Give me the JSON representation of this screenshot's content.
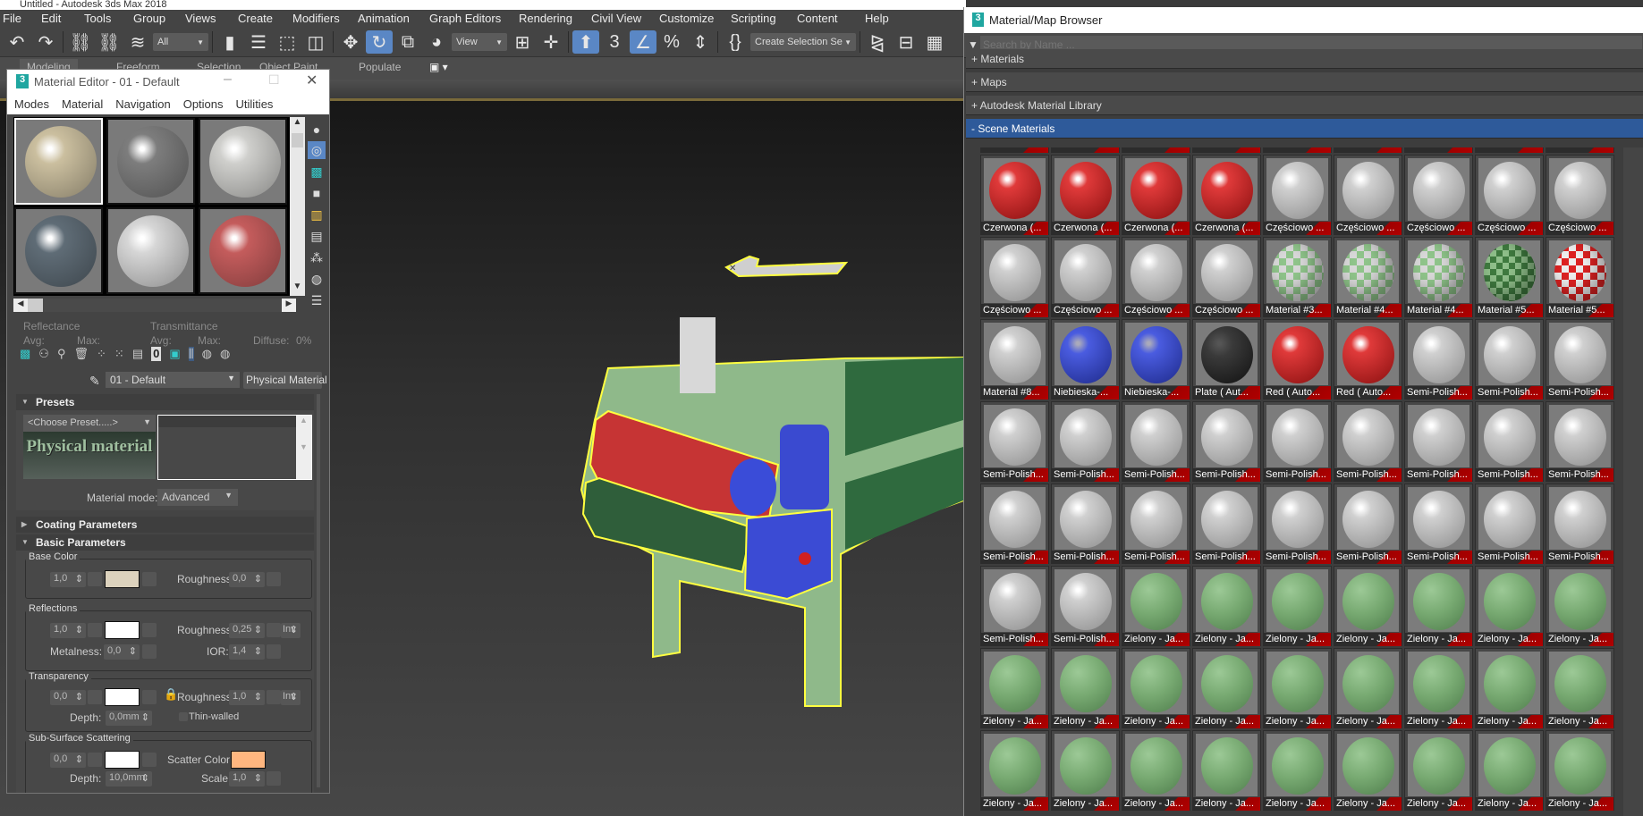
{
  "app": {
    "title": "Untitled - Autodesk 3ds Max 2018"
  },
  "menu": [
    "File",
    "Edit",
    "Tools",
    "Group",
    "Views",
    "Create",
    "Modifiers",
    "Animation",
    "Graph Editors",
    "Rendering",
    "Civil View",
    "Customize",
    "Scripting",
    "Content",
    "Help"
  ],
  "toolbar": {
    "selection_filter": "All",
    "ref_coord": "View",
    "named_selection": "Create Selection Se",
    "icons": [
      "undo-icon",
      "redo-icon",
      "link-icon",
      "unlink-icon",
      "bind-space-warp-icon",
      "select-object-icon",
      "select-by-name-icon",
      "rectangular-selection-icon",
      "window-crossing-icon",
      "move-icon",
      "rotate-icon",
      "scale-icon",
      "place-icon",
      "use-pivot-icon",
      "select-manipulate-icon",
      "keyboard-shortcut-override-icon",
      "snaps-toggle-icon",
      "angle-snap-icon",
      "percent-snap-icon",
      "spinner-snap-icon",
      "edit-named-selection-icon",
      "mirror-icon",
      "align-icon",
      "layer-explorer-icon"
    ],
    "active": [
      "rotate-icon",
      "keyboard-shortcut-override-icon",
      "angle-snap-icon"
    ]
  },
  "ribbon": {
    "tabs": [
      "Modeling",
      "Freeform",
      "Selection",
      "Object Paint",
      "Populate"
    ]
  },
  "material_editor": {
    "title": "Material Editor - 01 - Default",
    "menu": [
      "Modes",
      "Material",
      "Navigation",
      "Options",
      "Utilities"
    ],
    "slots": [
      {
        "color": "#cbbf9f"
      },
      {
        "color": "#7d7d7d"
      },
      {
        "color": "#cfcfcc"
      },
      {
        "color": "#5f6c76"
      },
      {
        "color": "#d6d6d6"
      },
      {
        "color": "#c45c5c"
      }
    ],
    "reflectance": {
      "label": "Reflectance",
      "avg": "Avg:",
      "max": "Max:"
    },
    "transmittance": {
      "label": "Transmittance",
      "avg": "Avg:",
      "max": "Max:",
      "diffuse": "Diffuse:",
      "diffuse_value": "0%"
    },
    "material_name": "01 - Default",
    "material_type": "Physical Material",
    "presets": {
      "title": "Presets",
      "choose": "<Choose Preset.....>",
      "logo": "Physical material",
      "mode_label": "Material mode:",
      "mode_value": "Advanced"
    },
    "coating": {
      "title": "Coating Parameters"
    },
    "basic": {
      "title": "Basic Parameters",
      "base_color": {
        "title": "Base Color",
        "weight": "1,0",
        "color": "#dcd2bd",
        "roughness_label": "Roughness:",
        "roughness": "0,0"
      },
      "reflections": {
        "title": "Reflections",
        "weight": "1,0",
        "color": "#ffffff",
        "roughness_label": "Roughness:",
        "roughness": "0,25",
        "inv": "Inv",
        "metalness_label": "Metalness:",
        "metalness": "0,0",
        "ior_label": "IOR:",
        "ior": "1,4"
      },
      "transparency": {
        "title": "Transparency",
        "weight": "0,0",
        "color": "#ffffff",
        "roughness_label": "Roughness:",
        "roughness": "1,0",
        "inv": "Inv",
        "depth_label": "Depth:",
        "depth": "0,0mm",
        "thin_walled": "Thin-walled"
      },
      "sss": {
        "title": "Sub-Surface Scattering",
        "weight": "0,0",
        "color": "#ffffff",
        "scatter_label": "Scatter Color:",
        "scatter_color": "#ffb67f",
        "depth_label": "Depth:",
        "depth": "10,0mm",
        "scale_label": "Scale:",
        "scale": "1,0"
      }
    }
  },
  "browser": {
    "title": "Material/Map Browser",
    "search_placeholder": "Search by Name ...",
    "categories": [
      "+ Materials",
      "+ Maps",
      "+ Autodesk Material Library",
      "- Scene Materials"
    ],
    "materials": [
      {
        "name": "Czerwona  (...",
        "type": "red"
      },
      {
        "name": "Czerwona  (...",
        "type": "red"
      },
      {
        "name": "Czerwona  (...",
        "type": "red"
      },
      {
        "name": "Czerwona  (...",
        "type": "red"
      },
      {
        "name": "Częściowo ...",
        "type": "grey"
      },
      {
        "name": "Częściowo ...",
        "type": "grey"
      },
      {
        "name": "Częściowo ...",
        "type": "grey"
      },
      {
        "name": "Częściowo ...",
        "type": "grey"
      },
      {
        "name": "Częściowo ...",
        "type": "grey"
      },
      {
        "name": "Częściowo ...",
        "type": "grey"
      },
      {
        "name": "Częściowo ...",
        "type": "grey"
      },
      {
        "name": "Częściowo ...",
        "type": "grey"
      },
      {
        "name": "Częściowo ...",
        "type": "grey"
      },
      {
        "name": "Material #3...",
        "type": "checker-green"
      },
      {
        "name": "Material #4...",
        "type": "checker-green"
      },
      {
        "name": "Material #4...",
        "type": "checker-green"
      },
      {
        "name": "Material #5...",
        "type": "checker-dark"
      },
      {
        "name": "Material #5...",
        "type": "checker-red"
      },
      {
        "name": "Material #8...",
        "type": "grey"
      },
      {
        "name": "Niebieska-...",
        "type": "blue"
      },
      {
        "name": "Niebieska-...",
        "type": "blue"
      },
      {
        "name": "Plate  ( Aut...",
        "type": "black"
      },
      {
        "name": "Red  ( Auto...",
        "type": "red"
      },
      {
        "name": "Red  ( Auto...",
        "type": "red"
      },
      {
        "name": "Semi-Polish...",
        "type": "grey"
      },
      {
        "name": "Semi-Polish...",
        "type": "grey"
      },
      {
        "name": "Semi-Polish...",
        "type": "grey"
      },
      {
        "name": "Semi-Polish...",
        "type": "grey"
      },
      {
        "name": "Semi-Polish...",
        "type": "grey"
      },
      {
        "name": "Semi-Polish...",
        "type": "grey"
      },
      {
        "name": "Semi-Polish...",
        "type": "grey"
      },
      {
        "name": "Semi-Polish...",
        "type": "grey"
      },
      {
        "name": "Semi-Polish...",
        "type": "grey"
      },
      {
        "name": "Semi-Polish...",
        "type": "grey"
      },
      {
        "name": "Semi-Polish...",
        "type": "grey"
      },
      {
        "name": "Semi-Polish...",
        "type": "grey"
      },
      {
        "name": "Semi-Polish...",
        "type": "grey"
      },
      {
        "name": "Semi-Polish...",
        "type": "grey"
      },
      {
        "name": "Semi-Polish...",
        "type": "grey"
      },
      {
        "name": "Semi-Polish...",
        "type": "grey"
      },
      {
        "name": "Semi-Polish...",
        "type": "grey"
      },
      {
        "name": "Semi-Polish...",
        "type": "grey"
      },
      {
        "name": "Semi-Polish...",
        "type": "grey"
      },
      {
        "name": "Semi-Polish...",
        "type": "grey"
      },
      {
        "name": "Semi-Polish...",
        "type": "grey"
      },
      {
        "name": "Semi-Polish...",
        "type": "grey"
      },
      {
        "name": "Semi-Polish...",
        "type": "grey"
      },
      {
        "name": "Zielony - Ja...",
        "type": "green"
      },
      {
        "name": "Zielony - Ja...",
        "type": "green"
      },
      {
        "name": "Zielony - Ja...",
        "type": "green"
      },
      {
        "name": "Zielony - Ja...",
        "type": "green"
      },
      {
        "name": "Zielony - Ja...",
        "type": "green"
      },
      {
        "name": "Zielony - Ja...",
        "type": "green"
      },
      {
        "name": "Zielony - Ja...",
        "type": "green"
      },
      {
        "name": "Zielony - Ja...",
        "type": "green"
      },
      {
        "name": "Zielony - Ja...",
        "type": "green"
      },
      {
        "name": "Zielony - Ja...",
        "type": "green"
      },
      {
        "name": "Zielony - Ja...",
        "type": "green"
      },
      {
        "name": "Zielony - Ja...",
        "type": "green"
      },
      {
        "name": "Zielony - Ja...",
        "type": "green"
      },
      {
        "name": "Zielony - Ja...",
        "type": "green"
      },
      {
        "name": "Zielony - Ja...",
        "type": "green"
      },
      {
        "name": "Zielony - Ja...",
        "type": "green"
      },
      {
        "name": "Zielony - Ja...",
        "type": "green"
      },
      {
        "name": "Zielony - Ja...",
        "type": "green"
      },
      {
        "name": "Zielony - Ja...",
        "type": "green"
      },
      {
        "name": "Zielony - Ja...",
        "type": "green"
      },
      {
        "name": "Zielony - Ja...",
        "type": "green"
      },
      {
        "name": "Zielony - Ja...",
        "type": "green"
      },
      {
        "name": "Zielony - Ja...",
        "type": "green"
      },
      {
        "name": "Zielony - Ja...",
        "type": "green"
      },
      {
        "name": "Zielony - Ja...",
        "type": "green"
      }
    ]
  },
  "colors": {
    "selection_outline": "#ffff40",
    "accent": "#5a87c5",
    "category_open": "#2e5a9a"
  }
}
